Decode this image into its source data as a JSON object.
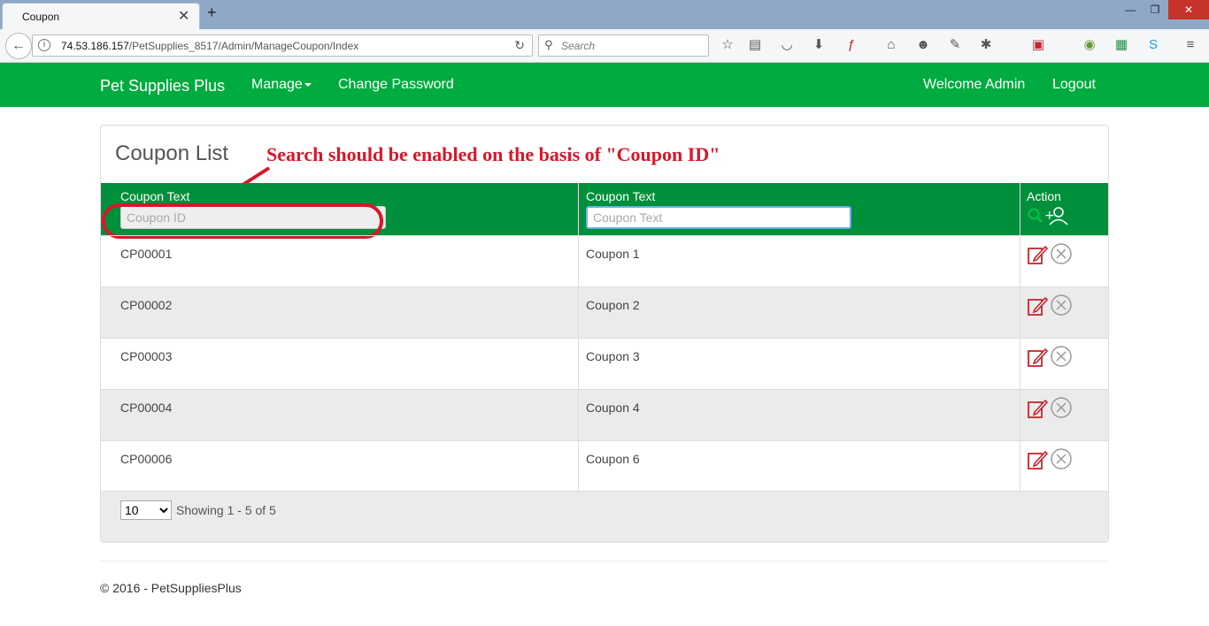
{
  "browser": {
    "tab_title": "Coupon",
    "new_tab": "+",
    "url_host": "74.53.186.157",
    "url_path": "/PetSupplies_8517/Admin/ManageCoupon/Index",
    "search_placeholder": "Search"
  },
  "site_nav": {
    "brand": "Pet Supplies Plus",
    "manage": "Manage",
    "change_password": "Change Password",
    "welcome": "Welcome Admin",
    "logout": "Logout",
    "bg_color": "#00ab3f"
  },
  "panel": {
    "title": "Coupon List",
    "annotation": "Search should be enabled on the basis of \"Coupon ID\"",
    "annotation_color": "#d5182a"
  },
  "table": {
    "header_color": "#008f3b",
    "columns": [
      {
        "label": "Coupon Text",
        "filter_placeholder": "Coupon ID",
        "filter_enabled": false
      },
      {
        "label": "Coupon Text",
        "filter_placeholder": "Coupon Text",
        "filter_enabled": true
      },
      {
        "label": "Action"
      }
    ],
    "rows": [
      {
        "id": "CP00001",
        "text": "Coupon 1"
      },
      {
        "id": "CP00002",
        "text": "Coupon 2"
      },
      {
        "id": "CP00003",
        "text": "Coupon 3"
      },
      {
        "id": "CP00004",
        "text": "Coupon 4"
      },
      {
        "id": "CP00006",
        "text": "Coupon 6"
      }
    ]
  },
  "pager": {
    "page_size": "10",
    "page_size_options": [
      "10"
    ],
    "showing": "Showing 1 - 5 of 5"
  },
  "footer": {
    "copyright": "© 2016 - PetSuppliesPlus"
  }
}
